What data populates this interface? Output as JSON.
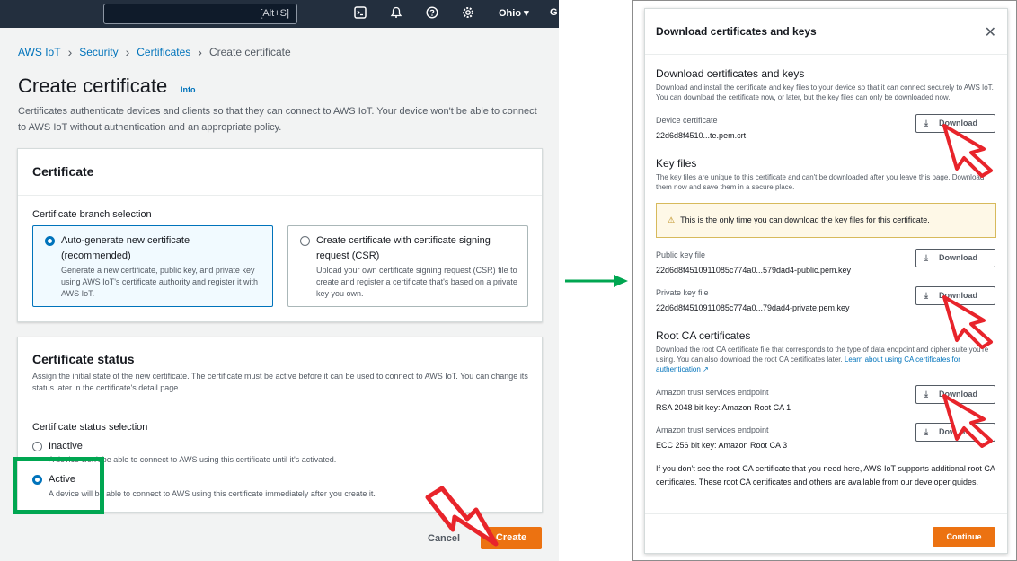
{
  "topbar": {
    "shortcut": "[Alt+S]",
    "region": "Ohio",
    "cut_text": "G"
  },
  "breadcrumb": [
    "AWS IoT",
    "Security",
    "Certificates",
    "Create certificate"
  ],
  "page": {
    "title": "Create certificate",
    "info": "Info",
    "description": "Certificates authenticate devices and clients so that they can connect to AWS IoT. Your device won't be able to connect to AWS IoT without authentication and an appropriate policy."
  },
  "certificate_card": {
    "heading": "Certificate",
    "branch_label": "Certificate branch selection",
    "option1_title": "Auto-generate new certificate (recommended)",
    "option1_desc": "Generate a new certificate, public key, and private key using AWS IoT's certificate authority and register it with AWS IoT.",
    "option2_title": "Create certificate with certificate signing request (CSR)",
    "option2_desc": "Upload your own certificate signing request (CSR) file to create and register a certificate that's based on a private key you own."
  },
  "status_card": {
    "heading": "Certificate status",
    "desc": "Assign the initial state of the new certificate. The certificate must be active before it can be used to connect to AWS IoT. You can change its status later in the certificate's detail page.",
    "selection_label": "Certificate status selection",
    "inactive_title": "Inactive",
    "inactive_desc": "A device won't be able to connect to AWS using this certificate until it's activated.",
    "active_title": "Active",
    "active_desc": "A device will be able to connect to AWS using this certificate immediately after you create it."
  },
  "actions": {
    "cancel": "Cancel",
    "create": "Create"
  },
  "modal": {
    "header": "Download certificates and keys",
    "section1_title": "Download certificates and keys",
    "section1_desc": "Download and install the certificate and key files to your device so that it can connect securely to AWS IoT. You can download the certificate now, or later, but the key files can only be downloaded now.",
    "device_cert_label": "Device certificate",
    "device_cert_value": "22d6d8f4510...te.pem.crt",
    "key_files_title": "Key files",
    "key_files_desc": "The key files are unique to this certificate and can't be downloaded after you leave this page. Download them now and save them in a secure place.",
    "warning": "This is the only time you can download the key files for this certificate.",
    "public_key_label": "Public key file",
    "public_key_value": "22d6d8f4510911085c774a0...579dad4-public.pem.key",
    "private_key_label": "Private key file",
    "private_key_value": "22d6d8f4510911085c774a0...79dad4-private.pem.key",
    "root_ca_title": "Root CA certificates",
    "root_ca_desc": "Download the root CA certificate file that corresponds to the type of data endpoint and cipher suite you're using. You can also download the root CA certificates later.",
    "root_ca_link": "Learn about using CA certificates for authentication",
    "endpoint1_label": "Amazon trust services endpoint",
    "endpoint1_value": "RSA 2048 bit key: Amazon Root CA 1",
    "endpoint2_label": "Amazon trust services endpoint",
    "endpoint2_value": "ECC 256 bit key: Amazon Root CA 3",
    "download_label": "Download",
    "footer_note": "If you don't see the root CA certificate that you need here, AWS IoT supports additional root CA certificates. These root CA certificates and others are available from our developer guides.",
    "continue": "Continue"
  },
  "colors": {
    "accent": "#ec7211",
    "link": "#0073bb",
    "highlight_box": "#00a651",
    "pointer": "#e8242b"
  }
}
